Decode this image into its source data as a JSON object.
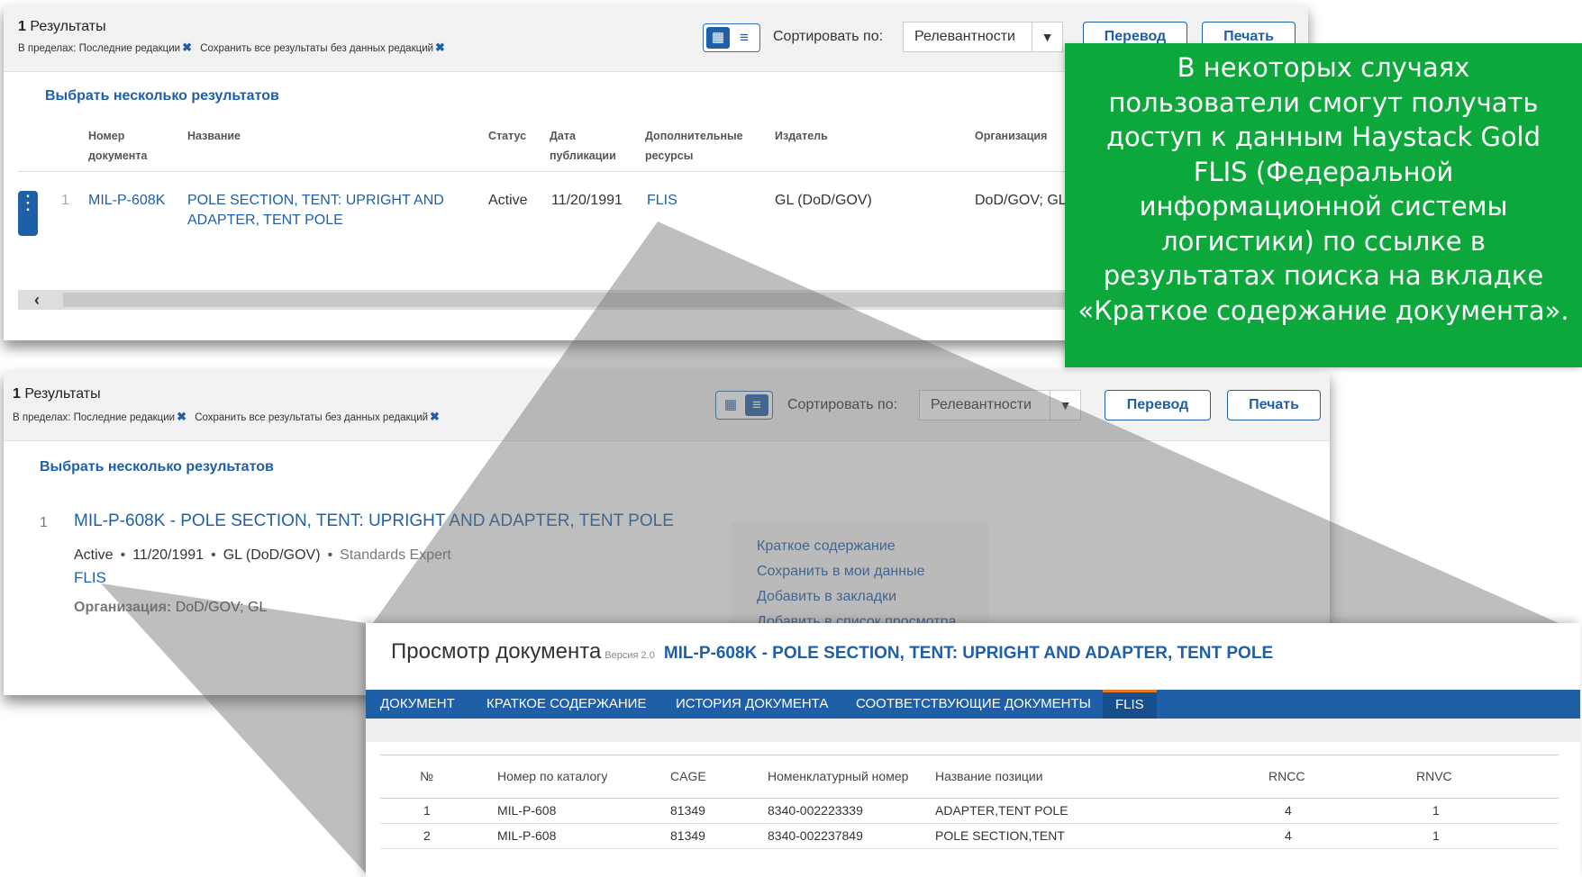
{
  "panel1": {
    "count": "1",
    "count_label": "Результаты",
    "filters": {
      "prefix": "В пределах:",
      "filter1": "Последние редакции",
      "filter2": "Сохранить все результаты без данных редакций"
    },
    "sort_label": "Сортировать по:",
    "sort_value": "Релевантности",
    "translate_button": "Перевод",
    "print_button": "Печать",
    "select_multiple": "Выбрать несколько результатов",
    "columns": [
      "Номер документа",
      "Название",
      "Статус",
      "Дата публикации",
      "Дополнительные ресурсы",
      "Издатель",
      "Организация"
    ],
    "row": {
      "num": "1",
      "doc_number": "MIL-P-608K",
      "title": "POLE SECTION, TENT: UPRIGHT AND ADAPTER, TENT POLE",
      "status": "Active",
      "date": "11/20/1991",
      "resources": "FLIS",
      "publisher": "GL (DoD/GOV)",
      "organization": "DoD/GOV; GL"
    }
  },
  "callout": "В некоторых случаях пользователи смогут получать доступ к данным Haystack Gold FLIS (Федеральной информационной системы логистики) по ссылке в результатах поиска на вкладке «Краткое содержание документа».",
  "panel2": {
    "count": "1",
    "count_label": "Результаты",
    "filters": {
      "prefix": "В пределах:",
      "filter1": "Последние редакции",
      "filter2": "Сохранить все результаты без данных редакций"
    },
    "sort_label": "Сортировать по:",
    "sort_value": "Релевантности",
    "translate_button": "Перевод",
    "print_button": "Печать",
    "select_multiple": "Выбрать несколько результатов",
    "item": {
      "num": "1",
      "title": "MIL-P-608K - POLE SECTION, TENT: UPRIGHT AND ADAPTER, TENT POLE",
      "status": "Active",
      "date": "11/20/1991",
      "publisher": "GL (DoD/GOV)",
      "source": "Standards Expert",
      "flis": "FLIS",
      "org_label": "Организация:",
      "org_value": "DoD/GOV; GL"
    },
    "actions": [
      "Краткое содержание",
      "Сохранить в мои данные",
      "Добавить в закладки",
      "Добавить в список просмотра"
    ]
  },
  "panel3": {
    "title": "Просмотр документа",
    "version": "Версия 2.0",
    "doc_title": "MIL-P-608K - POLE SECTION, TENT: UPRIGHT AND ADAPTER, TENT POLE",
    "tabs": [
      "ДОКУМЕНТ",
      "КРАТКОЕ СОДЕРЖАНИЕ",
      "ИСТОРИЯ ДОКУМЕНТА",
      "СООТВЕТСТВУЮЩИЕ ДОКУМЕНТЫ",
      "FLIS"
    ],
    "active_tab": "FLIS",
    "table": {
      "headers": [
        "№",
        "Номер по каталогу",
        "CAGE",
        "Номенклатурный номер",
        "Название позиции",
        "RNCC",
        "RNVC"
      ],
      "rows": [
        [
          "1",
          "MIL-P-608",
          "81349",
          "8340-002223339",
          "ADAPTER,TENT POLE",
          "4",
          "1"
        ],
        [
          "2",
          "MIL-P-608",
          "81349",
          "8340-002237849",
          "POLE SECTION,TENT",
          "4",
          "1"
        ]
      ]
    }
  },
  "colors": {
    "link": "#1f5fa8",
    "callout_bg": "#0da83b",
    "nav_bg": "#1f5fa8",
    "active_tab_accent": "#e87722"
  }
}
